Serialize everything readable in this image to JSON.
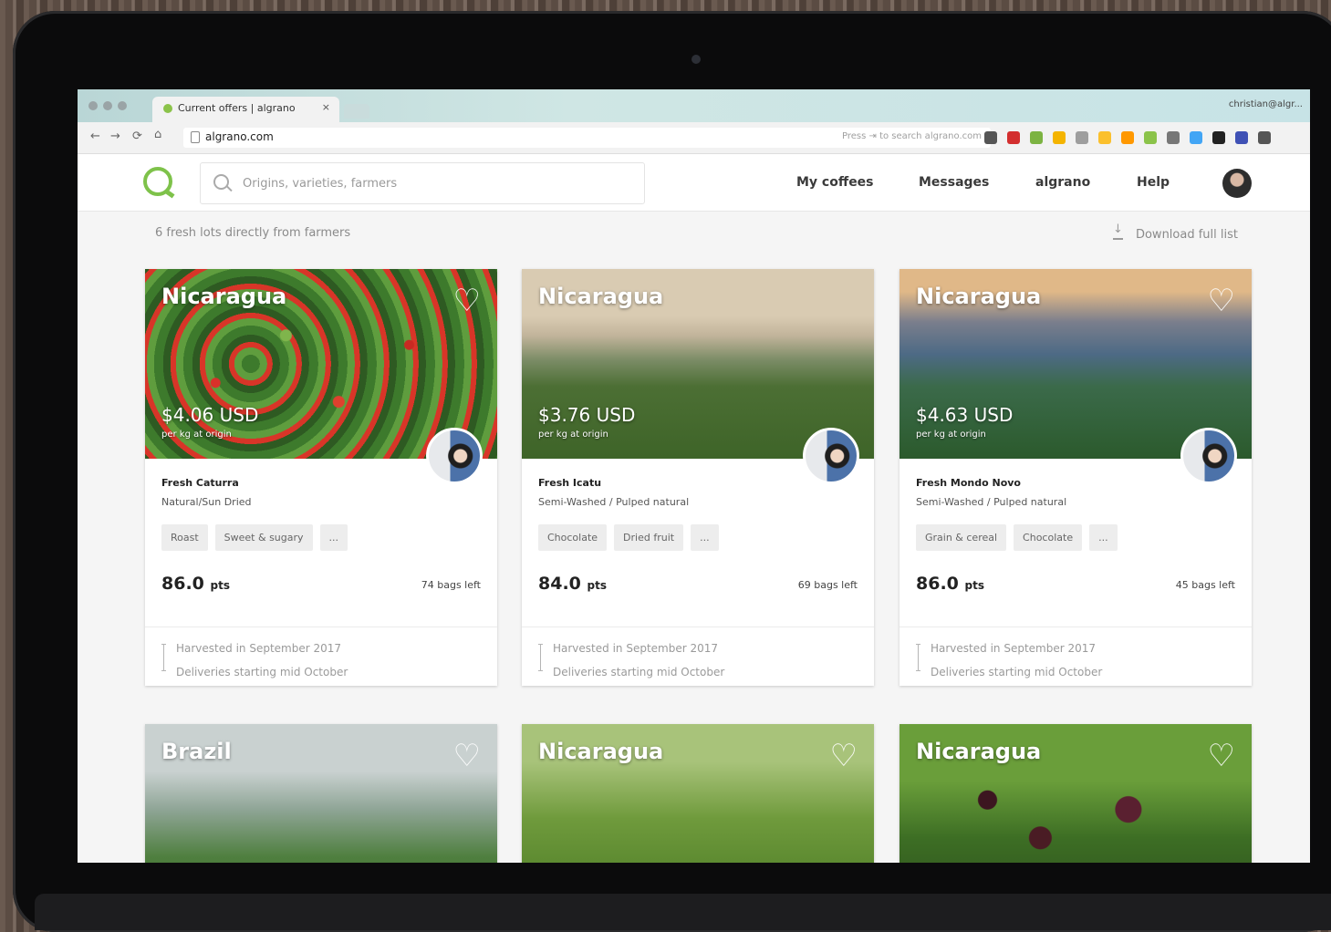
{
  "browser": {
    "tab_title": "Current offers | algrano",
    "tab_close": "×",
    "user": "christian@algr...",
    "url": "algrano.com",
    "url_hint": "Press  ⇥  to search algrano.com",
    "nav_back": "←",
    "nav_forward": "→",
    "nav_reload": "⟳",
    "nav_home": "⌂",
    "extension_colors": [
      "#555555",
      "#d32f2f",
      "#7cb342",
      "#f4b400",
      "#9e9e9e",
      "#fbc02d",
      "#ff9800",
      "#8bc34a",
      "#777777",
      "#42a5f5",
      "#222222",
      "#3f51b5",
      "#555555"
    ]
  },
  "header": {
    "search_placeholder": "Origins, varieties, farmers",
    "menu": [
      "My coffees",
      "Messages",
      "algrano",
      "Help"
    ],
    "accent_color": "#7ec24a"
  },
  "listing": {
    "summary": "6 fresh lots directly from farmers",
    "download_label": "Download full list"
  },
  "lots": [
    {
      "origin": "Nicaragua",
      "price": "$4.06 USD",
      "price_unit": "per kg at origin",
      "variety": "Fresh Caturra",
      "process": "Natural/Sun Dried",
      "tags": [
        "Roast",
        "Sweet & sugary",
        "..."
      ],
      "score": "86.0",
      "score_unit": "pts",
      "bags": "74 bags left",
      "harvest": "Harvested in September 2017",
      "delivery": "Deliveries starting mid October",
      "heart": "♡"
    },
    {
      "origin": "Nicaragua",
      "price": "$3.76 USD",
      "price_unit": "per kg at origin",
      "variety": "Fresh Icatu",
      "process": "Semi-Washed / Pulped natural",
      "tags": [
        "Chocolate",
        "Dried fruit",
        "..."
      ],
      "score": "84.0",
      "score_unit": "pts",
      "bags": "69 bags left",
      "harvest": "Harvested in September 2017",
      "delivery": "Deliveries starting mid October",
      "heart": "♡"
    },
    {
      "origin": "Nicaragua",
      "price": "$4.63 USD",
      "price_unit": "per kg at origin",
      "variety": "Fresh Mondo Novo",
      "process": "Semi-Washed / Pulped natural",
      "tags": [
        "Grain & cereal",
        "Chocolate",
        "..."
      ],
      "score": "86.0",
      "score_unit": "pts",
      "bags": "45 bags left",
      "harvest": "Harvested in September 2017",
      "delivery": "Deliveries starting mid October",
      "heart": "♡"
    },
    {
      "origin": "Brazil",
      "heart": "♡"
    },
    {
      "origin": "Nicaragua",
      "heart": "♡"
    },
    {
      "origin": "Nicaragua",
      "heart": "♡"
    }
  ]
}
